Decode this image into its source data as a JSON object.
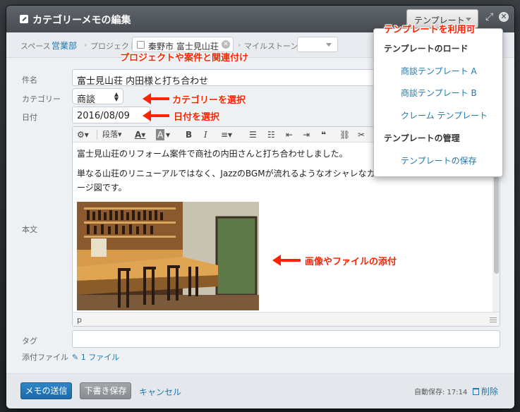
{
  "dialog": {
    "title": "カテゴリーメモの編集",
    "template_button": "テンプレート"
  },
  "breadcrumb": {
    "space_label": "スペース",
    "space_value": "営業部",
    "project_label": "プロジェクト",
    "project_value": "秦野市 富士見山荘",
    "milestone_label": "マイルストーン"
  },
  "form": {
    "subject_label": "件名",
    "subject_value": "富士見山荘 内田様と打ち合わせ",
    "category_label": "カテゴリー",
    "category_value": "商談",
    "date_label": "日付",
    "date_value": "2016/08/09",
    "body_label": "本文",
    "tag_label": "タグ",
    "attachment_label": "添付ファイル",
    "attachment_value": "1 ファイル"
  },
  "editor": {
    "format_label": "段落",
    "paragraph1": "富士見山荘のリフォーム案件で商社の内田さんと打ち合わせしました。",
    "paragraph2_line1": "単なる山荘のリニューアルではなく、JazzのBGMが流れるようなオシャレなカ",
    "paragraph2_line2": "ージ図です。",
    "status_path": "p"
  },
  "template_menu": {
    "load_header": "テンプレートのロード",
    "items": [
      "商談テンプレート A",
      "商談テンプレート B",
      "クレーム テンプレート"
    ],
    "manage_header": "テンプレートの管理",
    "save_item": "テンプレートの保存"
  },
  "footer": {
    "send_button": "メモの送信",
    "draft_button": "下書き保存",
    "cancel_link": "キャンセル",
    "autosave_text": "自動保存: 17:14",
    "delete_link": "削除"
  },
  "annotations": {
    "template": "テンプレートを利用可",
    "project": "プロジェクトや案件と関連付け",
    "category": "カテゴリーを選択",
    "date": "日付を選択",
    "image": "画像やファイルの添付"
  },
  "colors": {
    "accent": "#1c78b0",
    "annotation": "#ff2200",
    "primary_button": "#1d6aa8"
  }
}
